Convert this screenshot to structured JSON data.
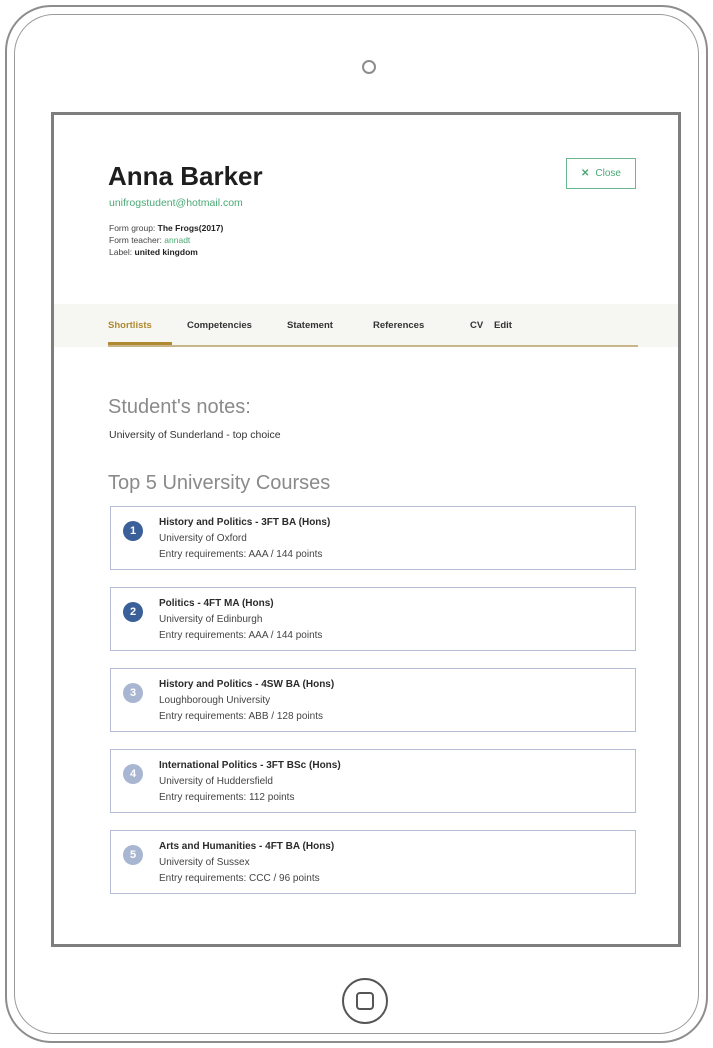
{
  "student": {
    "name": "Anna Barker",
    "email": "unifrogstudent@hotmail.com",
    "form_group_label": "Form group:",
    "form_group_value": "The Frogs(2017)",
    "form_teacher_label": "Form teacher:",
    "form_teacher_value": "annadt",
    "label_label": "Label:",
    "label_value": "united kingdom"
  },
  "close_button": {
    "icon": "close-icon",
    "label": "Close"
  },
  "tabs": [
    {
      "label": "Shortlists",
      "active": true
    },
    {
      "label": "Competencies",
      "active": false
    },
    {
      "label": "Statement",
      "active": false
    },
    {
      "label": "References",
      "active": false
    },
    {
      "label": "CV",
      "active": false
    },
    {
      "label": "Edit",
      "active": false
    }
  ],
  "notes": {
    "heading": "Student's notes:",
    "text": "University of Sunderland - top choice"
  },
  "courses_heading": "Top 5 University Courses",
  "courses": [
    {
      "rank": "1",
      "title": "History and Politics - 3FT BA (Hons)",
      "university": "University of Oxford",
      "entry": "Entry requirements: AAA / 144 points",
      "badge_color": "#3a5f99"
    },
    {
      "rank": "2",
      "title": "Politics - 4FT MA (Hons)",
      "university": "University of Edinburgh",
      "entry": "Entry requirements: AAA / 144 points",
      "badge_color": "#3a5f99"
    },
    {
      "rank": "3",
      "title": "History and Politics - 4SW BA (Hons)",
      "university": "Loughborough University",
      "entry": "Entry requirements: ABB / 128 points",
      "badge_color": "#a9b6d2"
    },
    {
      "rank": "4",
      "title": "International Politics - 3FT BSc (Hons)",
      "university": "University of Huddersfield",
      "entry": "Entry requirements: 112 points",
      "badge_color": "#a9b6d2"
    },
    {
      "rank": "5",
      "title": "Arts and Humanities - 4FT BA (Hons)",
      "university": "University of Sussex",
      "entry": "Entry requirements: CCC / 96 points",
      "badge_color": "#a9b6d2"
    }
  ],
  "colors": {
    "accent_green": "#4aa874",
    "active_tab": "#b08a30",
    "badge_dark": "#3a5f99",
    "badge_light": "#a9b6d2"
  }
}
